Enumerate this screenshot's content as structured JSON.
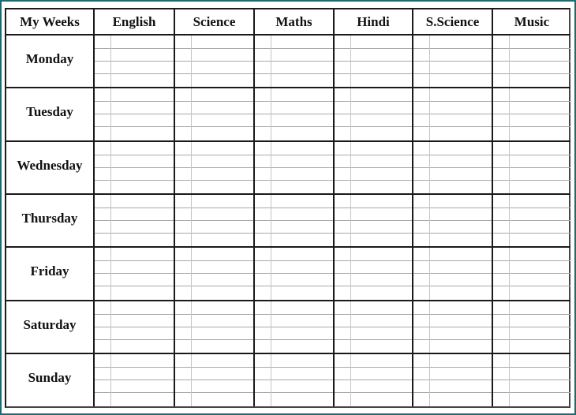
{
  "timetable": {
    "corner_label": "My Weeks",
    "subjects": [
      "English",
      "Science",
      "Maths",
      "Hindi",
      "S.Science",
      "Music"
    ],
    "days": [
      "Monday",
      "Tuesday",
      "Wednesday",
      "Thursday",
      "Friday",
      "Saturday",
      "Sunday"
    ],
    "frame_color": "#1f6a6c"
  }
}
